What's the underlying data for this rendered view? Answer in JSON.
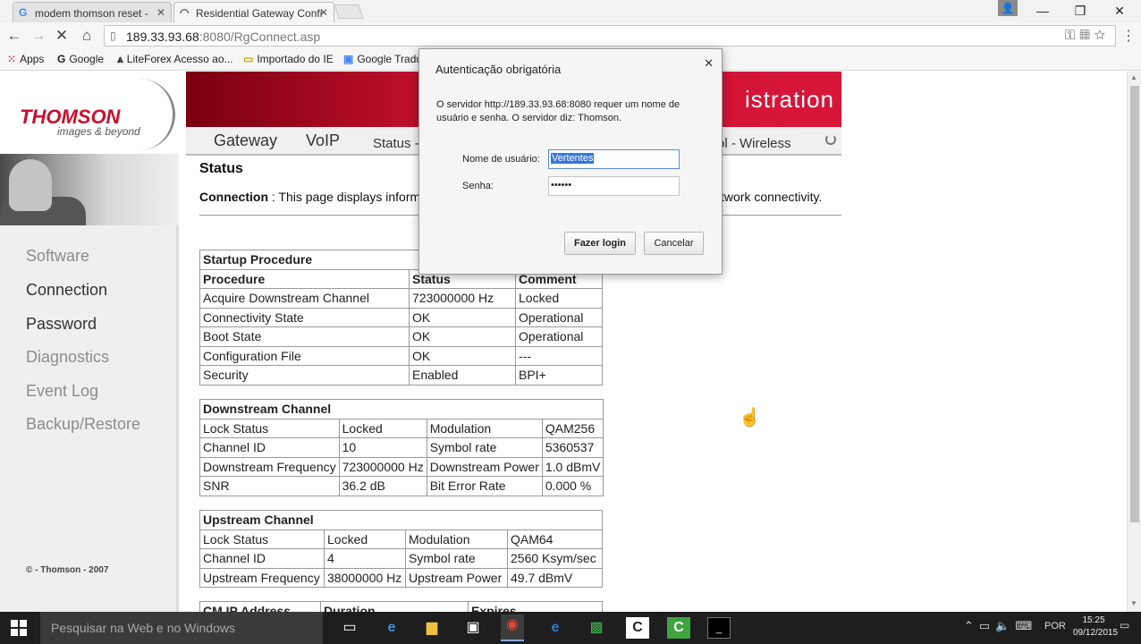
{
  "browser": {
    "tabs": [
      {
        "label": "modem thomson reset - ",
        "icon": "google-g-icon"
      },
      {
        "label": "Residential Gateway Confi",
        "icon": "loading-spinner-icon"
      }
    ],
    "url_host": "189.33.93.68",
    "url_path": ":8080/RgConnect.asp",
    "bookmarks": [
      {
        "label": "Apps",
        "icon": "apps-grid-icon"
      },
      {
        "label": "Google",
        "icon": "google-g-icon"
      },
      {
        "label": "LiteForex  Acesso ao...",
        "icon": "liteforex-icon"
      },
      {
        "label": "Importado do IE",
        "icon": "folder-icon"
      },
      {
        "label": "Google Tradu",
        "icon": "google-translate-icon"
      }
    ]
  },
  "header": {
    "brand": "THOMSON",
    "tagline": "images & beyond",
    "banner_title": "istration",
    "nav": [
      "Gateway",
      "VoIP",
      "Status -",
      "ol -  Wireless"
    ]
  },
  "sidebar": {
    "items": [
      "Software",
      "Connection",
      "Password",
      "Diagnostics",
      "Event Log",
      "Backup/Restore"
    ],
    "copyright": "© - Thomson - 2007"
  },
  "main": {
    "heading": "Status",
    "desc_label": "Connection",
    "desc_left": "  :  This page displays inform",
    "desc_right": "twork connectivity.",
    "startup": {
      "caption": "Startup Procedure",
      "headers": [
        "Procedure",
        "Status",
        "Comment"
      ],
      "rows": [
        [
          "Acquire Downstream Channel",
          "723000000 Hz",
          "Locked"
        ],
        [
          "Connectivity State",
          "OK",
          "Operational"
        ],
        [
          "Boot State",
          "OK",
          "Operational"
        ],
        [
          "Configuration File",
          "OK",
          "---"
        ],
        [
          "Security",
          "Enabled",
          "BPI+"
        ]
      ]
    },
    "downstream": {
      "caption": "Downstream Channel",
      "rows": [
        [
          "Lock Status",
          "Locked",
          "Modulation",
          "QAM256"
        ],
        [
          "Channel ID",
          "10",
          "Symbol rate",
          "5360537"
        ],
        [
          "Downstream Frequency",
          "723000000 Hz",
          "Downstream Power",
          "1.0 dBmV"
        ],
        [
          "SNR",
          "36.2 dB",
          "Bit Error Rate",
          "0.000 %"
        ]
      ]
    },
    "upstream": {
      "caption": "Upstream Channel",
      "rows": [
        [
          "Lock Status",
          "Locked",
          "Modulation",
          "QAM64"
        ],
        [
          "Channel ID",
          "4",
          "Symbol rate",
          "2560 Ksym/sec"
        ],
        [
          "Upstream Frequency",
          "38000000 Hz",
          "Upstream Power",
          "49.7 dBmV"
        ]
      ]
    },
    "partial_headers": [
      "CM IP Address",
      "Duration",
      "Expires"
    ]
  },
  "dialog": {
    "title": "Autenticação obrigatória",
    "message": "O servidor http://189.33.93.68:8080 requer um nome de usuário e senha. O servidor diz: Thomson.",
    "username_label": "Nome de usuário:",
    "username_value": "Vertentes",
    "password_label": "Senha:",
    "password_value": "••••••",
    "login_button": "Fazer login",
    "cancel_button": "Cancelar"
  },
  "taskbar": {
    "search_placeholder": "Pesquisar na Web e no Windows",
    "language": "POR",
    "time": "15:25",
    "date": "09/12/2015"
  }
}
